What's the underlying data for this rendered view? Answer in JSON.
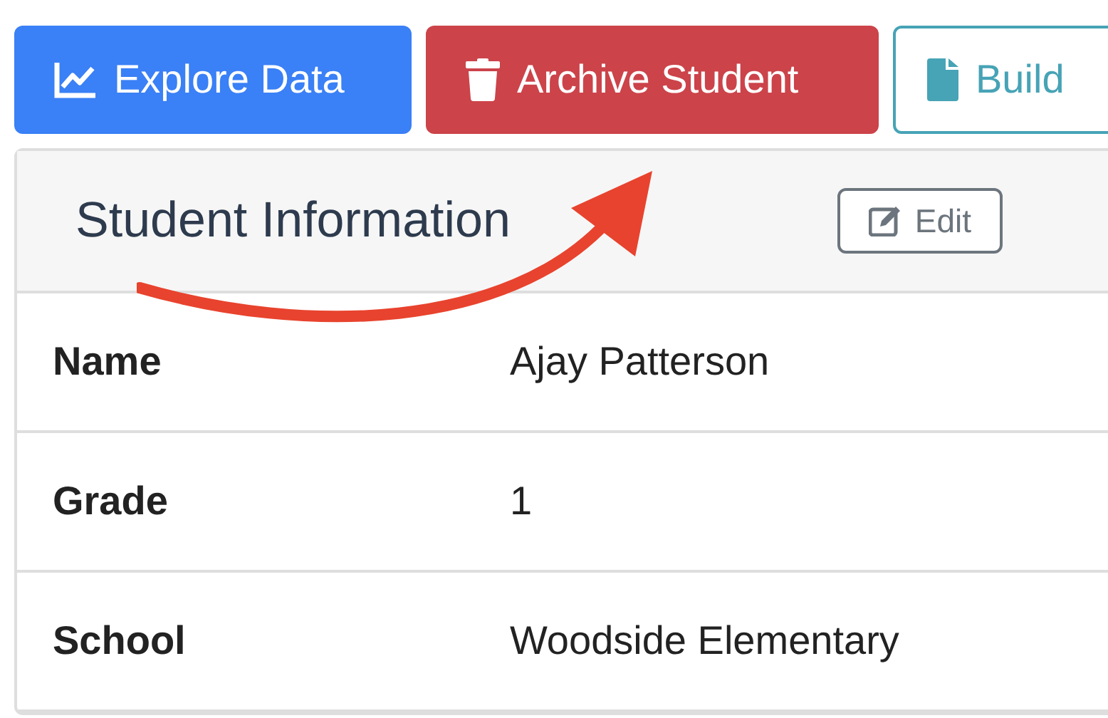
{
  "toolbar": [
    {
      "kind": "chart",
      "label": "Explore Data"
    },
    {
      "kind": "trash",
      "label": "Archive Student"
    },
    {
      "kind": "file",
      "label": "Build"
    }
  ],
  "card": {
    "title": "Student Information",
    "edit_button": "Edit",
    "rows": [
      {
        "label": "Name",
        "value": "Ajay Patterson"
      },
      {
        "label": "Grade",
        "value": "1"
      },
      {
        "label": "School",
        "value": "Woodside Elementary"
      }
    ]
  },
  "annotations": [
    {
      "kind": "arrow"
    }
  ]
}
